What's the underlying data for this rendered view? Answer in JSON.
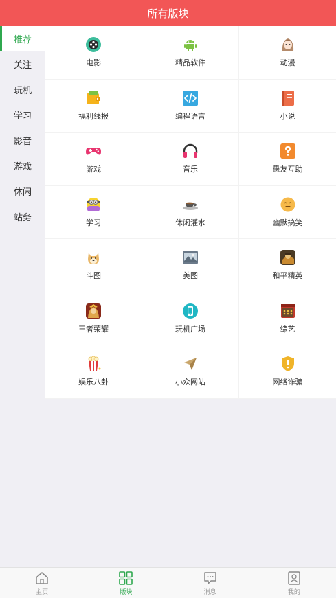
{
  "header": {
    "title": "所有版块"
  },
  "sidebar": {
    "items": [
      {
        "label": "推荐",
        "active": true
      },
      {
        "label": "关注"
      },
      {
        "label": "玩机"
      },
      {
        "label": "学习"
      },
      {
        "label": "影音"
      },
      {
        "label": "游戏"
      },
      {
        "label": "休闲"
      },
      {
        "label": "站务"
      }
    ]
  },
  "grid": {
    "items": [
      {
        "label": "电影",
        "icon": "film-reel-icon"
      },
      {
        "label": "精品软件",
        "icon": "android-icon"
      },
      {
        "label": "动漫",
        "icon": "anime-girl-icon"
      },
      {
        "label": "福利线报",
        "icon": "wallet-icon"
      },
      {
        "label": "编程语言",
        "icon": "code-icon"
      },
      {
        "label": "小说",
        "icon": "book-icon"
      },
      {
        "label": "游戏",
        "icon": "gamepad-icon"
      },
      {
        "label": "音乐",
        "icon": "headphones-icon"
      },
      {
        "label": "愚友互助",
        "icon": "question-icon"
      },
      {
        "label": "学习",
        "icon": "minion-icon"
      },
      {
        "label": "休闲灌水",
        "icon": "coffee-cup-icon"
      },
      {
        "label": "幽默搞笑",
        "icon": "laughing-face-icon"
      },
      {
        "label": "斗图",
        "icon": "doge-icon"
      },
      {
        "label": "美图",
        "icon": "photo-icon"
      },
      {
        "label": "和平精英",
        "icon": "peace-elite-icon"
      },
      {
        "label": "王者荣耀",
        "icon": "honor-of-kings-icon"
      },
      {
        "label": "玩机广场",
        "icon": "phone-icon"
      },
      {
        "label": "综艺",
        "icon": "stage-icon"
      },
      {
        "label": "娱乐八卦",
        "icon": "popcorn-icon"
      },
      {
        "label": "小众网站",
        "icon": "paper-plane-icon"
      },
      {
        "label": "网络诈骗",
        "icon": "shield-warning-icon"
      }
    ]
  },
  "bottom_nav": {
    "items": [
      {
        "label": "主页",
        "icon": "home-icon"
      },
      {
        "label": "版块",
        "icon": "grid-icon",
        "active": true
      },
      {
        "label": "消息",
        "icon": "message-icon"
      },
      {
        "label": "我的",
        "icon": "profile-icon"
      }
    ]
  },
  "colors": {
    "header": "#f25656",
    "accent": "#2fa84f",
    "background": "#f0eff4"
  }
}
